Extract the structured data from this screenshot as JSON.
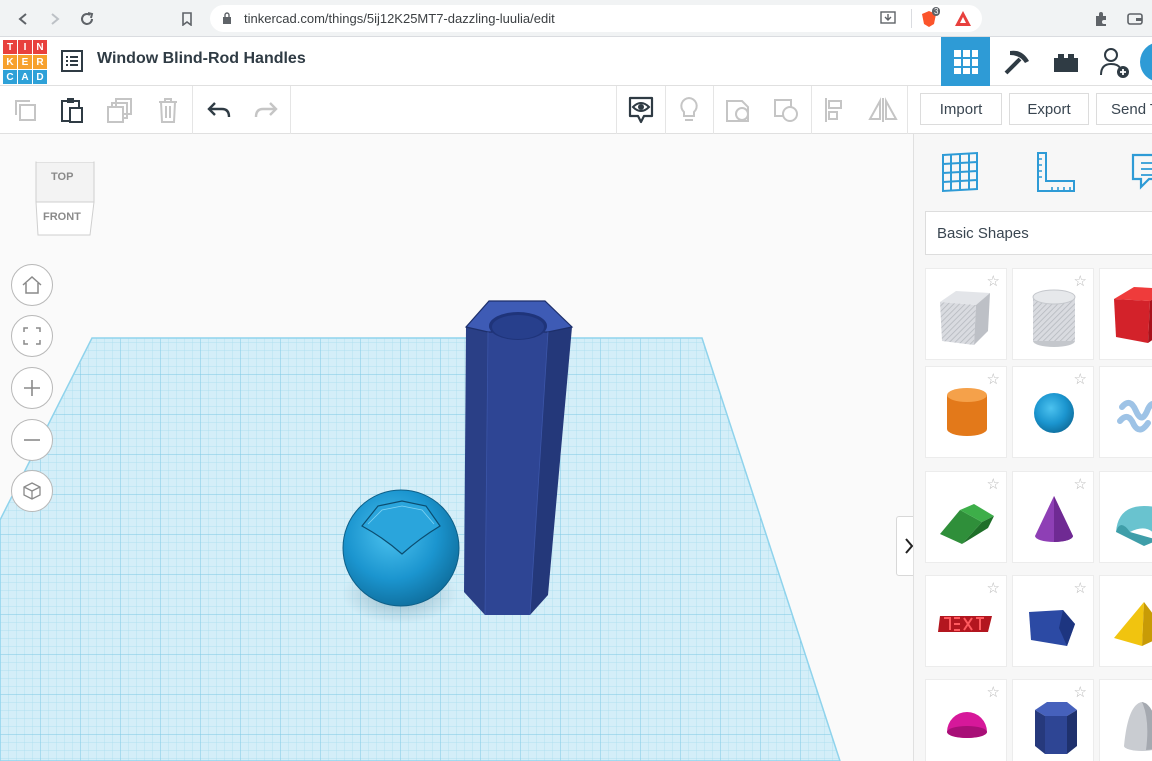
{
  "browser": {
    "url": "tinkercad.com/things/5ij12K25MT7-dazzling-luulia/edit",
    "extension_badge": "3"
  },
  "app": {
    "logo_letters": [
      "T",
      "I",
      "N",
      "K",
      "E",
      "R",
      "C",
      "A",
      "D"
    ],
    "logo_colors": [
      "#e8403d",
      "#e8403d",
      "#e8403d",
      "#f7a12d",
      "#f7a12d",
      "#f7a12d",
      "#2ea1d8",
      "#2ea1d8",
      "#2ea1d8"
    ],
    "design_title": "Window Blind-Rod Handles"
  },
  "toolbar": {
    "import_label": "Import",
    "export_label": "Export",
    "send_label": "Send T"
  },
  "viewcube": {
    "top_label": "TOP",
    "front_label": "FRONT"
  },
  "right_panel": {
    "category_label": "Basic Shapes",
    "shapes": [
      {
        "name": "box-hole"
      },
      {
        "name": "cylinder-hole"
      },
      {
        "name": "box"
      },
      {
        "name": "cylinder"
      },
      {
        "name": "sphere"
      },
      {
        "name": "scribble"
      },
      {
        "name": "roof"
      },
      {
        "name": "cone"
      },
      {
        "name": "round-roof"
      },
      {
        "name": "text"
      },
      {
        "name": "polygon"
      },
      {
        "name": "pyramid"
      },
      {
        "name": "half-sphere"
      },
      {
        "name": "hexagonal-prism"
      },
      {
        "name": "paraboloid"
      }
    ]
  },
  "colors": {
    "accent_blue": "#2e9bd6",
    "grid_blue": "#8fd3ec",
    "hex_prism": "#2b4490",
    "sphere": "#1b95cf"
  }
}
